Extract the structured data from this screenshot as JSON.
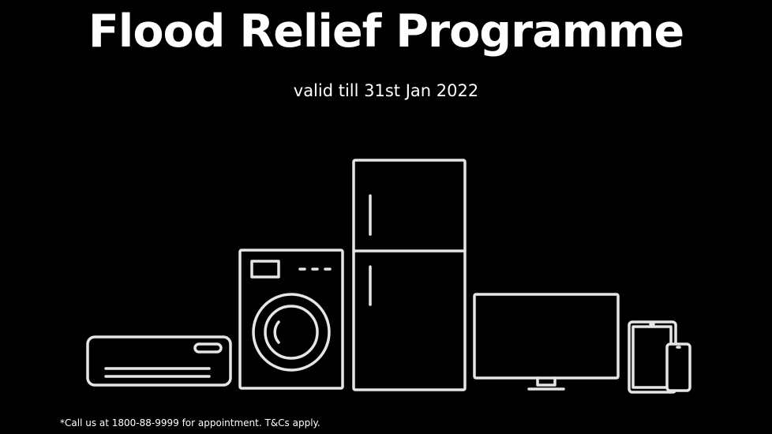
{
  "banner": {
    "title": "Flood Relief Programme",
    "validity": "valid till 31st Jan 2022",
    "disclaimer": "*Call us at 1800-88-9999 for appointment. T&Cs apply."
  },
  "appliances": [
    {
      "name": "air-conditioner-icon"
    },
    {
      "name": "washing-machine-icon"
    },
    {
      "name": "refrigerator-icon"
    },
    {
      "name": "monitor-icon"
    },
    {
      "name": "tablet-and-phone-icon"
    }
  ],
  "colors": {
    "background": "#000000",
    "text": "#ffffff",
    "line_art": "#e6e6e6"
  }
}
